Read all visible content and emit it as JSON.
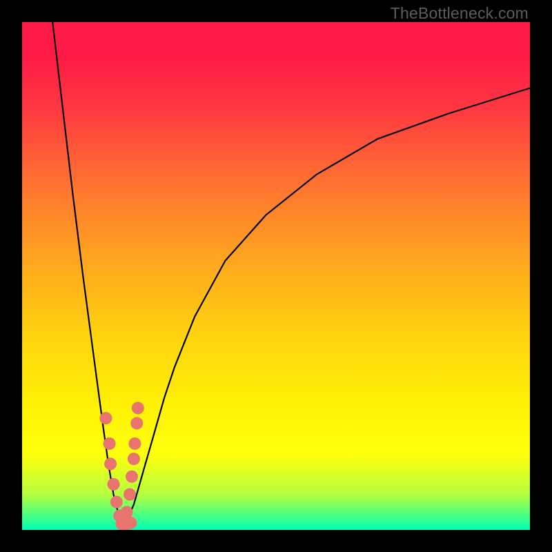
{
  "watermark": "TheBottleneck.com",
  "colors": {
    "frame": "#000000",
    "bead": "#e9736e",
    "curve": "#000000"
  },
  "chart_data": {
    "type": "line",
    "title": "",
    "xlabel": "",
    "ylabel": "",
    "xlim": [
      0,
      100
    ],
    "ylim": [
      0,
      100
    ],
    "grid": false,
    "note": "Axes are unlabeled; values are estimated by pixel position. y≈0 at bottom, y≈100 at top. The curve has a sharp minimum near x≈20 and rises steeply on both sides (left branch nearly vertical, right branch rising toward ~y≈87 at the right edge).",
    "series": [
      {
        "name": "left-branch",
        "x": [
          6,
          8,
          10,
          12,
          14,
          16,
          17,
          18,
          19,
          20
        ],
        "values": [
          100,
          83,
          66,
          50,
          35,
          20,
          13,
          7,
          3,
          0.5
        ]
      },
      {
        "name": "right-branch",
        "x": [
          20,
          22,
          24,
          26,
          28,
          30,
          34,
          40,
          48,
          58,
          70,
          84,
          100
        ],
        "values": [
          0.5,
          5,
          12,
          19,
          26,
          32,
          42,
          53,
          62,
          70,
          77,
          82,
          87
        ]
      }
    ],
    "beads": {
      "note": "Decorative pink markers clustered near the vertex on both branches.",
      "left": [
        {
          "x": 16.5,
          "y": 22
        },
        {
          "x": 17.2,
          "y": 17
        },
        {
          "x": 17.4,
          "y": 13
        },
        {
          "x": 18.0,
          "y": 9
        },
        {
          "x": 18.6,
          "y": 5.5
        },
        {
          "x": 19.2,
          "y": 2.8
        }
      ],
      "right": [
        {
          "x": 22.8,
          "y": 24
        },
        {
          "x": 22.6,
          "y": 21
        },
        {
          "x": 22.2,
          "y": 17
        },
        {
          "x": 22.0,
          "y": 14
        },
        {
          "x": 21.6,
          "y": 10.5
        },
        {
          "x": 21.2,
          "y": 7
        },
        {
          "x": 20.6,
          "y": 3.5
        }
      ],
      "bottom": [
        {
          "x": 19.6,
          "y": 1.2
        },
        {
          "x": 20.6,
          "y": 1.2
        },
        {
          "x": 21.4,
          "y": 1.4
        }
      ]
    }
  }
}
